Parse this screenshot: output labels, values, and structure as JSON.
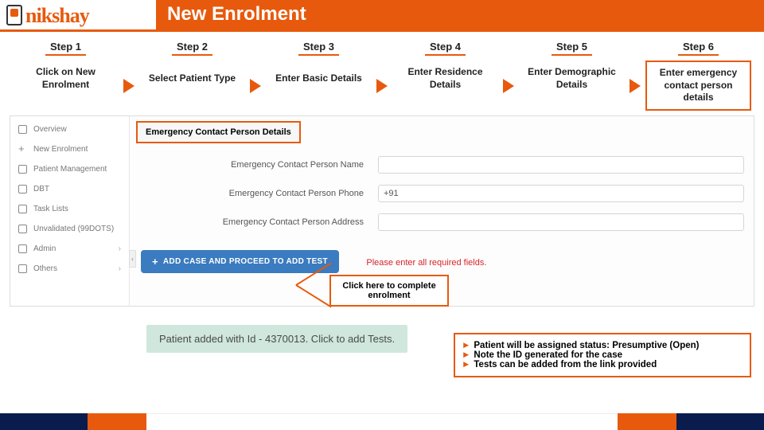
{
  "header": {
    "title": "New Enrolment",
    "logo_text": "nikshay"
  },
  "steps": [
    {
      "label": "Step 1",
      "desc": "Click on New Enrolment"
    },
    {
      "label": "Step 2",
      "desc": "Select Patient Type"
    },
    {
      "label": "Step 3",
      "desc": "Enter Basic Details"
    },
    {
      "label": "Step 4",
      "desc": "Enter Residence Details"
    },
    {
      "label": "Step 5",
      "desc": "Enter Demographic Details"
    },
    {
      "label": "Step 6",
      "desc": "Enter emergency contact person details"
    }
  ],
  "sidebar": {
    "items": [
      "Overview",
      "New Enrolment",
      "Patient Management",
      "DBT",
      "Task Lists",
      "Unvalidated (99DOTS)",
      "Admin",
      "Others"
    ]
  },
  "form": {
    "section_title": "Emergency Contact Person Details",
    "rows": [
      {
        "label": "Emergency Contact Person Name",
        "value": "",
        "placeholder": ""
      },
      {
        "label": "Emergency Contact Person Phone",
        "value": "+91",
        "placeholder": ""
      },
      {
        "label": "Emergency Contact Person Address",
        "value": "",
        "placeholder": ""
      }
    ],
    "add_button": "ADD CASE AND PROCEED TO ADD TEST",
    "error": "Please enter all required fields."
  },
  "callout": {
    "text": "Click here to complete enrolment"
  },
  "success": {
    "text": "Patient added with Id - 4370013. Click to add Tests."
  },
  "notes": [
    "Patient will be assigned status: Presumptive (Open)",
    "Note the ID generated for the case",
    "Tests can be added from the link provided"
  ]
}
